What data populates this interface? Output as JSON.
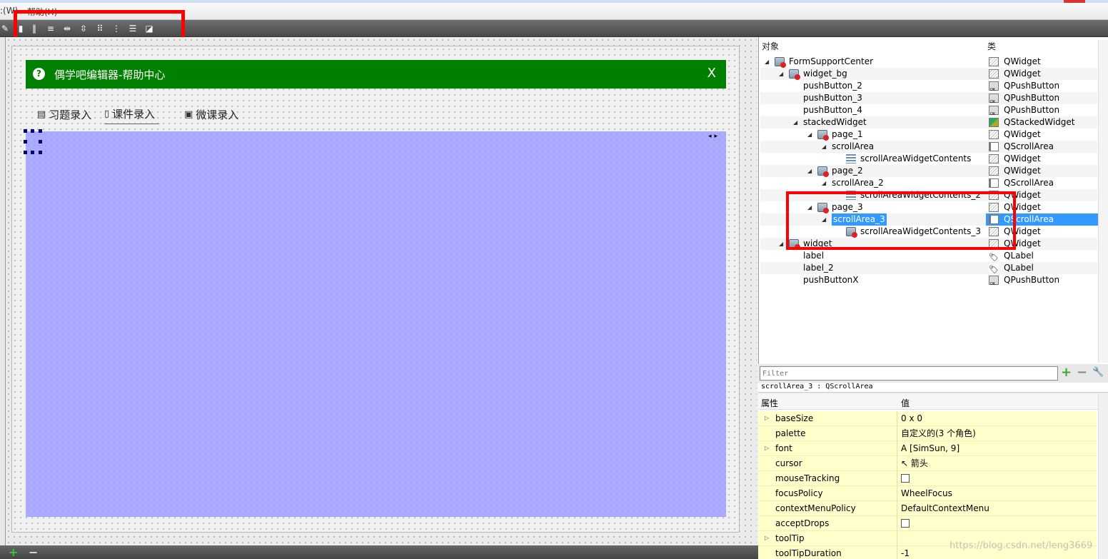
{
  "menubar": {
    "items": [
      ":(W)",
      "帮助(H)"
    ]
  },
  "toolbar": {
    "icons": [
      "edit-widgets-icon",
      "edit-buddies-icon",
      "layout-horizontal-icon",
      "layout-vertical-icon",
      "layout-hsplit-icon",
      "layout-vsplit-icon",
      "layout-form-icon",
      "layout-grid-icon",
      "break-layout-icon",
      "adjust-size-icon"
    ]
  },
  "form": {
    "title": "偶学吧编辑器-帮助中心",
    "close_label": "X",
    "help_glyph": "?",
    "tabs": [
      {
        "label": "习题录入",
        "active": false
      },
      {
        "label": "课件录入",
        "active": true
      },
      {
        "label": "微课录入",
        "active": false
      }
    ],
    "stack_arrows": "◂▸",
    "colors": {
      "title_bg": "#008000",
      "stack_bg": "#aaaaff"
    }
  },
  "inspector": {
    "col_object": "对象",
    "col_class": "类",
    "rows": [
      {
        "name": "FormSupportCenter",
        "cls": "QWidget",
        "depth": 0,
        "expand": true,
        "icon": "widget-red"
      },
      {
        "name": "widget_bg",
        "cls": "QWidget",
        "depth": 1,
        "expand": true,
        "icon": "widget-red"
      },
      {
        "name": "pushButton_2",
        "cls": "QPushButton",
        "depth": 2,
        "expand": false,
        "icon": ""
      },
      {
        "name": "pushButton_3",
        "cls": "QPushButton",
        "depth": 2,
        "expand": false,
        "icon": ""
      },
      {
        "name": "pushButton_4",
        "cls": "QPushButton",
        "depth": 2,
        "expand": false,
        "icon": ""
      },
      {
        "name": "stackedWidget",
        "cls": "QStackedWidget",
        "depth": 2,
        "expand": true,
        "icon": ""
      },
      {
        "name": "page_1",
        "cls": "QWidget",
        "depth": 3,
        "expand": true,
        "icon": "widget-red"
      },
      {
        "name": "scrollArea",
        "cls": "QScrollArea",
        "depth": 4,
        "expand": true,
        "icon": ""
      },
      {
        "name": "scrollAreaWidgetContents",
        "cls": "QWidget",
        "depth": 5,
        "expand": false,
        "icon": "list"
      },
      {
        "name": "page_2",
        "cls": "QWidget",
        "depth": 3,
        "expand": true,
        "icon": "widget-red"
      },
      {
        "name": "scrollArea_2",
        "cls": "QScrollArea",
        "depth": 4,
        "expand": true,
        "icon": ""
      },
      {
        "name": "scrollAreaWidgetContents_2",
        "cls": "QWidget",
        "depth": 5,
        "expand": false,
        "icon": "list"
      },
      {
        "name": "page_3",
        "cls": "QWidget",
        "depth": 3,
        "expand": true,
        "icon": "widget-red"
      },
      {
        "name": "scrollArea_3",
        "cls": "QScrollArea",
        "depth": 4,
        "expand": true,
        "icon": "",
        "selected": true
      },
      {
        "name": "scrollAreaWidgetContents_3",
        "cls": "QWidget",
        "depth": 5,
        "expand": false,
        "icon": "widget-red"
      },
      {
        "name": "widget",
        "cls": "QWidget",
        "depth": 1,
        "expand": true,
        "icon": "widget-red"
      },
      {
        "name": "label",
        "cls": "QLabel",
        "depth": 2,
        "expand": false,
        "icon": ""
      },
      {
        "name": "label_2",
        "cls": "QLabel",
        "depth": 2,
        "expand": false,
        "icon": ""
      },
      {
        "name": "pushButtonX",
        "cls": "QPushButton",
        "depth": 2,
        "expand": false,
        "icon": ""
      }
    ]
  },
  "filter": {
    "placeholder": "Filter",
    "add": "+",
    "remove": "−",
    "wrench": "🔧"
  },
  "class_line": "scrollArea_3 : QScrollArea",
  "properties": {
    "col_prop": "属性",
    "col_value": "值",
    "rows": [
      {
        "name": "baseSize",
        "value": "0 x 0",
        "expandable": true,
        "type": "text"
      },
      {
        "name": "palette",
        "value": "自定义的(3 个角色)",
        "expandable": false,
        "type": "text"
      },
      {
        "name": "font",
        "value": "[SimSun, 9]",
        "expandable": true,
        "type": "font"
      },
      {
        "name": "cursor",
        "value": "箭头",
        "expandable": false,
        "type": "cursor"
      },
      {
        "name": "mouseTracking",
        "value": "",
        "expandable": false,
        "type": "check"
      },
      {
        "name": "focusPolicy",
        "value": "WheelFocus",
        "expandable": false,
        "type": "text"
      },
      {
        "name": "contextMenuPolicy",
        "value": "DefaultContextMenu",
        "expandable": false,
        "type": "text"
      },
      {
        "name": "acceptDrops",
        "value": "",
        "expandable": false,
        "type": "check"
      },
      {
        "name": "toolTip",
        "value": "",
        "expandable": true,
        "type": "text"
      },
      {
        "name": "toolTipDuration",
        "value": "-1",
        "expandable": false,
        "type": "text"
      }
    ]
  },
  "watermark": "https://blog.csdn.net/leng3669"
}
